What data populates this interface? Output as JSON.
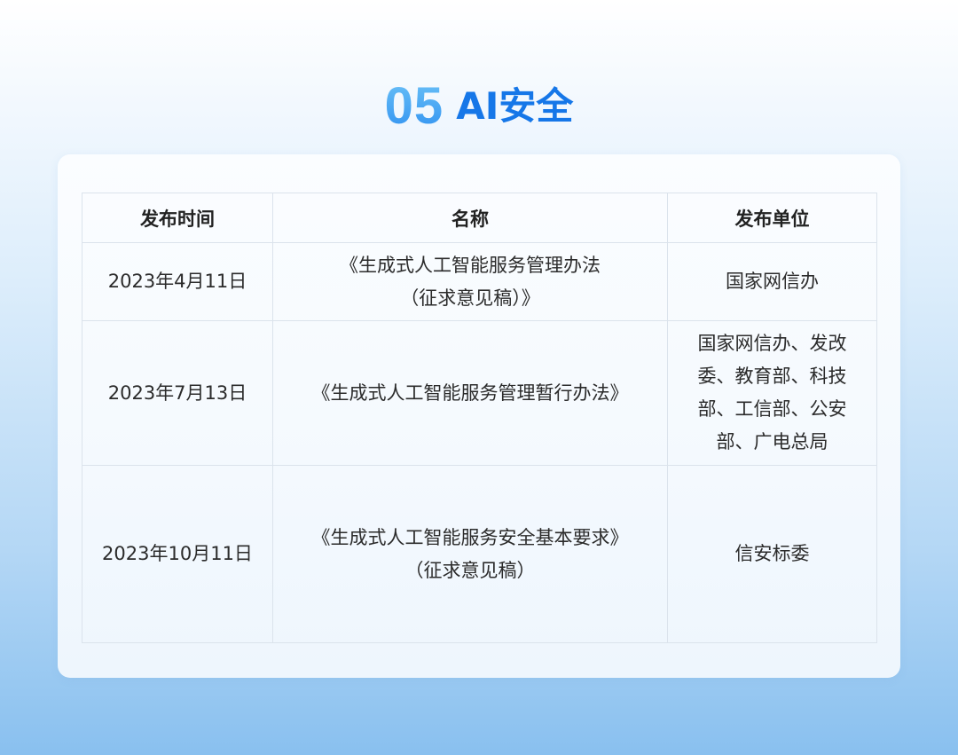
{
  "header": {
    "number": "05",
    "title": "AI安全"
  },
  "table": {
    "columns": [
      "发布时间",
      "名称",
      "发布单位"
    ],
    "rows": [
      {
        "date": "2023年4月11日",
        "name_lines": [
          "《生成式人工智能服务管理办法",
          "（征求意见稿）》"
        ],
        "org_lines": [
          "国家网信办"
        ]
      },
      {
        "date": "2023年7月13日",
        "name_lines": [
          "《生成式人工智能服务管理暂行办法》"
        ],
        "org_lines": [
          "国家网信办、发改",
          "委、教育部、科技",
          "部、工信部、公安",
          "部、广电总局"
        ]
      },
      {
        "date": "2023年10月11日",
        "name_lines": [
          "《生成式人工智能服务安全基本要求》",
          "（征求意见稿）"
        ],
        "org_lines": [
          "信安标委"
        ]
      }
    ]
  }
}
